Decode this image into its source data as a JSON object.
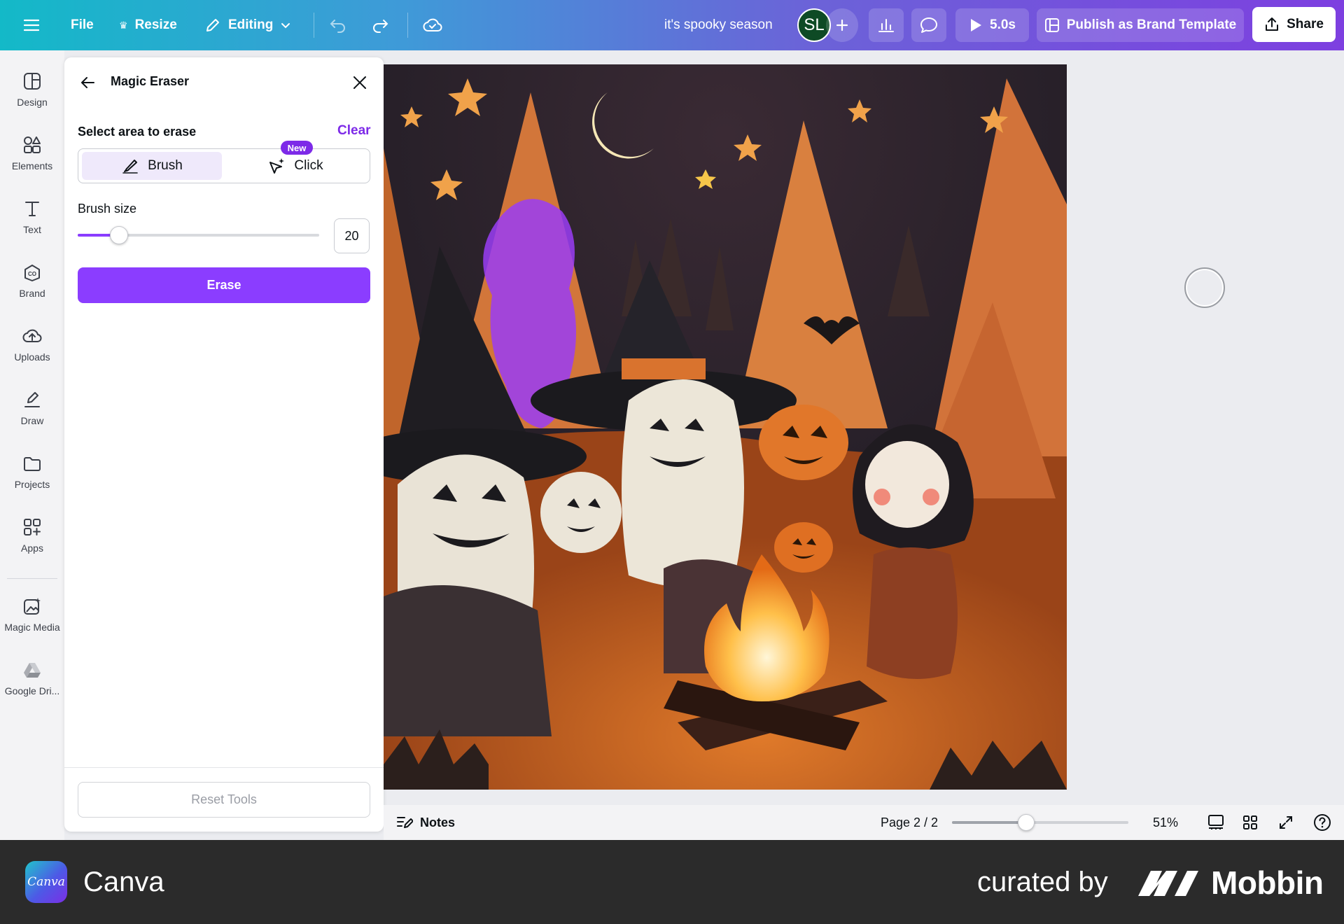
{
  "topbar": {
    "file": "File",
    "resize": "Resize",
    "editing": "Editing",
    "doc_title": "it's spooky season",
    "avatar_initials": "SL",
    "timer": "5.0s",
    "publish": "Publish as Brand Template",
    "share": "Share"
  },
  "rail": {
    "items": [
      {
        "label": "Design",
        "icon": "design-icon"
      },
      {
        "label": "Elements",
        "icon": "elements-icon"
      },
      {
        "label": "Text",
        "icon": "text-icon"
      },
      {
        "label": "Brand",
        "icon": "brand-icon"
      },
      {
        "label": "Uploads",
        "icon": "uploads-icon"
      },
      {
        "label": "Draw",
        "icon": "draw-icon"
      },
      {
        "label": "Projects",
        "icon": "projects-icon"
      },
      {
        "label": "Apps",
        "icon": "apps-icon"
      },
      {
        "label": "Magic Media",
        "icon": "magic-media-icon"
      },
      {
        "label": "Google Dri...",
        "icon": "google-drive-icon"
      }
    ]
  },
  "panel": {
    "title": "Magic Eraser",
    "select_label": "Select area to erase",
    "clear": "Clear",
    "brush": "Brush",
    "click": "Click",
    "new_badge": "New",
    "brush_size_label": "Brush size",
    "brush_size_value": "20",
    "brush_size_fraction": 0.17,
    "erase": "Erase",
    "reset": "Reset Tools"
  },
  "bottombar": {
    "notes": "Notes",
    "page": "Page 2 / 2",
    "zoom": "51%",
    "zoom_fraction": 0.42
  },
  "footer": {
    "logo_text": "Canva",
    "app_name": "Canva",
    "curated_by": "curated by",
    "brand": "Mobbin"
  },
  "colors": {
    "accent": "#8b3dff",
    "link": "#7d2ae8",
    "avatar_bg": "#0e4a25"
  }
}
